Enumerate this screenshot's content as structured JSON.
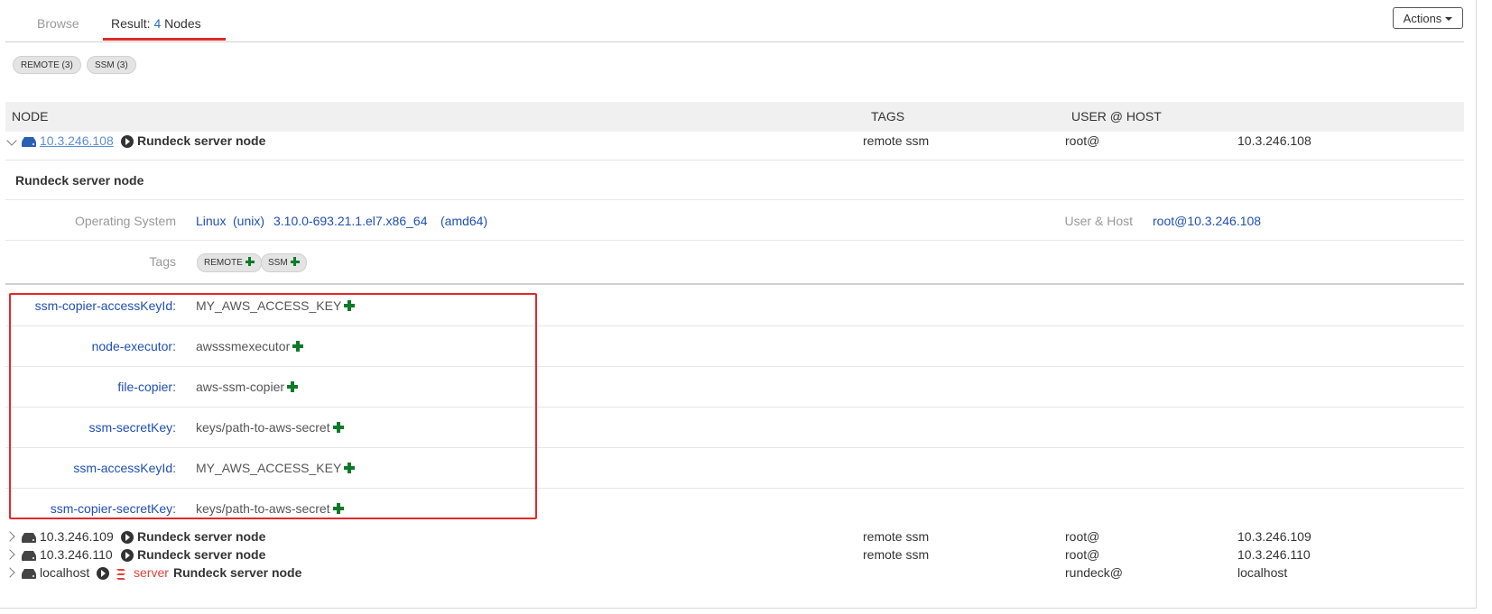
{
  "tabs": {
    "browse": "Browse",
    "result_prefix": "Result:",
    "result_count": "4",
    "result_suffix": "Nodes"
  },
  "actions_label": "Actions",
  "filter_pills": [
    "REMOTE (3)",
    "SSM (3)"
  ],
  "table_headers": {
    "node": "NODE",
    "tags": "TAGS",
    "user_host": "USER @ HOST"
  },
  "expanded_node": {
    "name": "10.3.246.108",
    "description": "Rundeck server node",
    "tags_text": "remote ssm",
    "user": "root@",
    "host": "10.3.246.108",
    "detail_title": "Rundeck server node",
    "os_label": "Operating System",
    "os_family": "Linux",
    "os_type": "(unix)",
    "os_version": "3.10.0-693.21.1.el7.x86_64",
    "os_arch": "(amd64)",
    "user_host_label": "User & Host",
    "user_host_value": "root@10.3.246.108",
    "tags_label": "Tags",
    "tag_pills": [
      "REMOTE",
      "SSM"
    ],
    "attributes": [
      {
        "key": "ssm-copier-accessKeyId:",
        "value": "MY_AWS_ACCESS_KEY"
      },
      {
        "key": "node-executor:",
        "value": "awsssmexecutor"
      },
      {
        "key": "file-copier:",
        "value": "aws-ssm-copier"
      },
      {
        "key": "ssm-secretKey:",
        "value": "keys/path-to-aws-secret"
      },
      {
        "key": "ssm-accessKeyId:",
        "value": "MY_AWS_ACCESS_KEY"
      },
      {
        "key": "ssm-copier-secretKey:",
        "value": "keys/path-to-aws-secret"
      }
    ]
  },
  "other_nodes": [
    {
      "name": "10.3.246.109",
      "description": "Rundeck server node",
      "tags_text": "remote ssm",
      "user": "root@",
      "host": "10.3.246.109"
    },
    {
      "name": "10.3.246.110",
      "description": "Rundeck server node",
      "tags_text": "remote ssm",
      "user": "root@",
      "host": "10.3.246.110"
    },
    {
      "name": "localhost",
      "server_label": "server",
      "description": "Rundeck server node",
      "tags_text": "",
      "user": "rundeck@",
      "host": "localhost"
    }
  ],
  "colors": {
    "accent_red": "#e02a2a",
    "link_blue": "#1f4fb5",
    "plus_green": "#0e7a28"
  }
}
